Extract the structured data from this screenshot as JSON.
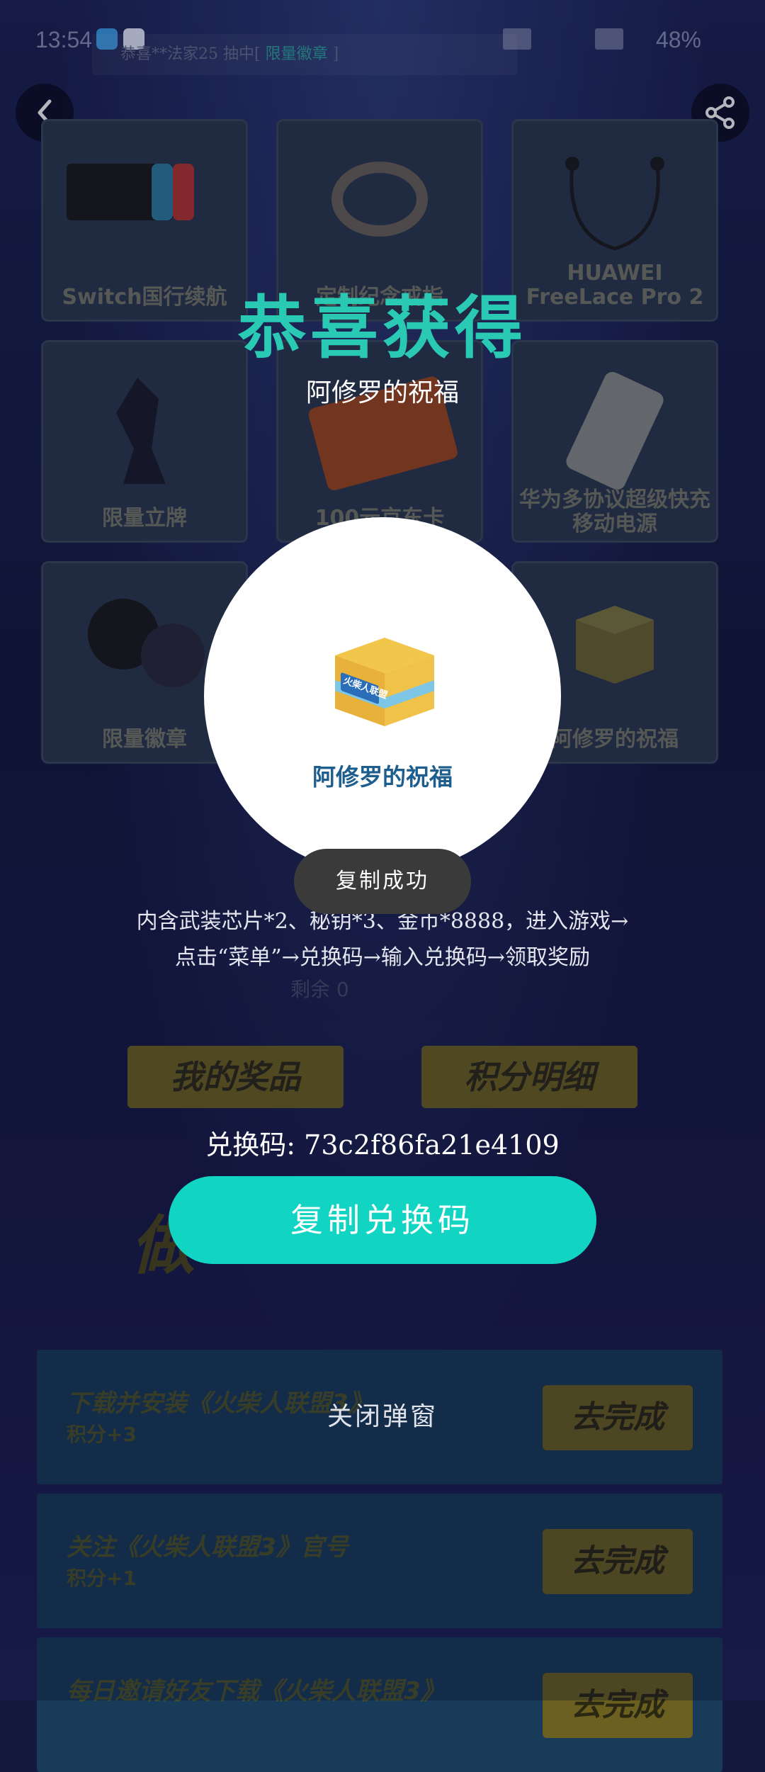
{
  "status_bar": {
    "time": "13:54",
    "battery": "48%"
  },
  "ticker": {
    "text": "恭喜**法家25 抽中[ ",
    "highlight": "限量徽章",
    "suffix": " ]"
  },
  "prizes": [
    {
      "label": "Switch国行续航"
    },
    {
      "label": "定制纪念戒指"
    },
    {
      "label": "HUAWEI FreeLace Pro 2"
    },
    {
      "label": "限量立牌"
    },
    {
      "label": "100元京东卡"
    },
    {
      "label": "华为多协议超级快充移动电源"
    },
    {
      "label": "限量徽章"
    },
    {
      "label": "阿修罗的祝福"
    }
  ],
  "remaining_label": "剩余",
  "remaining_value": "0",
  "buttons": {
    "my_prizes": "我的奖品",
    "points_detail": "积分明细"
  },
  "section_title": "做",
  "tasks": [
    {
      "title": "下载并安装《火柴人联盟3》",
      "points": "积分+3",
      "action": "去完成"
    },
    {
      "title": "关注《火柴人联盟3》官号",
      "points": "积分+1",
      "action": "去完成"
    },
    {
      "title": "每日邀请好友下载《火柴人联盟3》",
      "points": "",
      "action": "去完成"
    }
  ],
  "modal": {
    "title": "恭喜获得",
    "prize_name": "阿修罗的祝福",
    "item_name": "阿修罗的祝福",
    "box_logo_text": "火柴人联盟",
    "toast": "复制成功",
    "description": "内含武装芯片*2、秘钥*3、金币*8888，进入游戏→点击“菜单”→兑换码→输入兑换码→领取奖励",
    "code_label": "兑换码: 73c2f86fa21e4109",
    "copy_button": "复制兑换码",
    "close": "关闭弹窗"
  },
  "colors": {
    "accent": "#12d4c2",
    "title_teal": "#29c9b4",
    "item_blue": "#1e5e8e"
  }
}
